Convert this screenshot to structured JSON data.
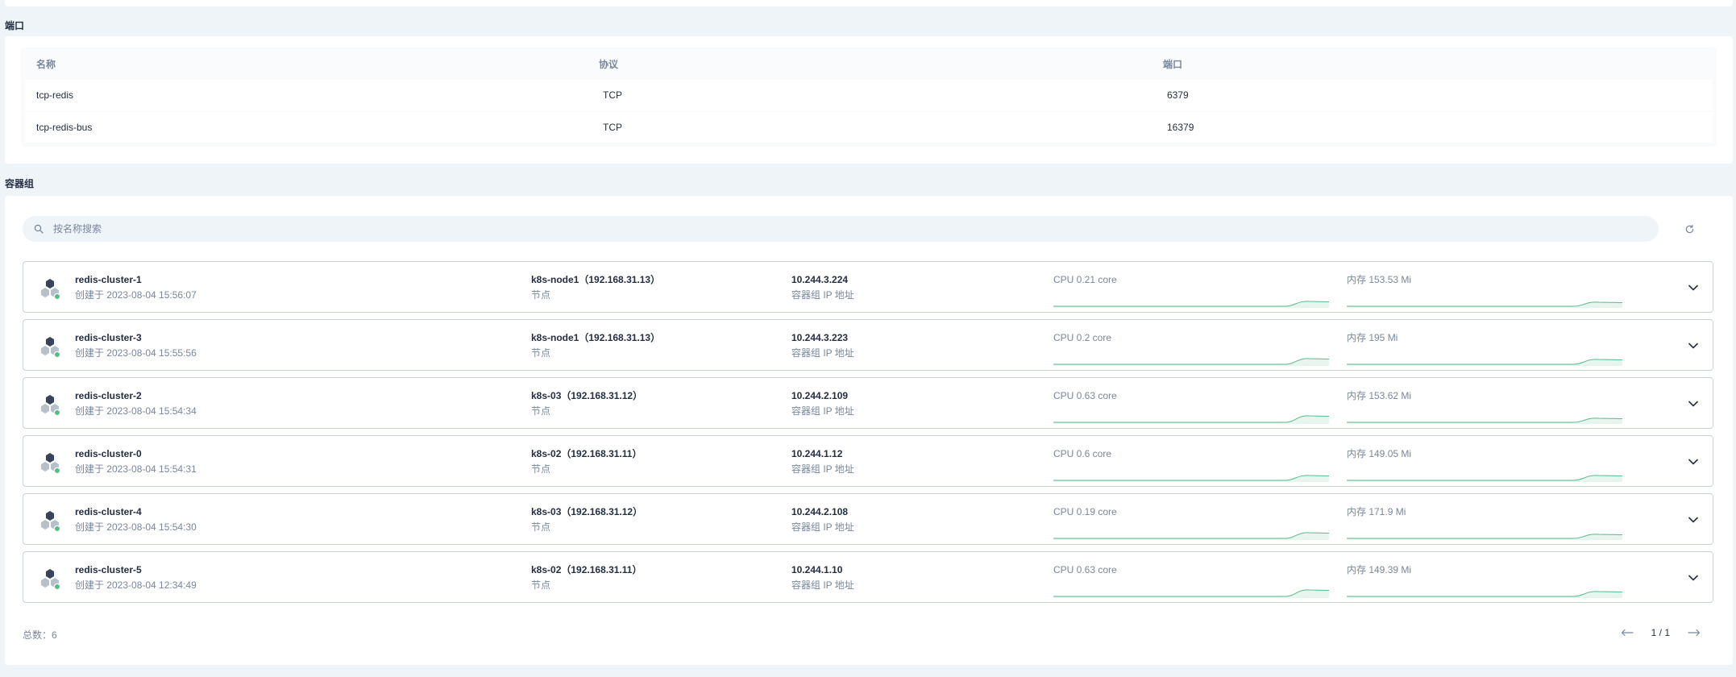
{
  "sections": {
    "ports_title": "端口",
    "pods_title": "容器组"
  },
  "ports": {
    "headers": [
      "名称",
      "协议",
      "端口"
    ],
    "rows": [
      [
        "tcp-redis",
        "TCP",
        "6379"
      ],
      [
        "tcp-redis-bus",
        "TCP",
        "16379"
      ]
    ]
  },
  "search": {
    "placeholder": "按名称搜索"
  },
  "pods": [
    {
      "name": "redis-cluster-1",
      "created": "创建于 2023-08-04 15:56:07",
      "node": "k8s-node1（192.168.31.13）",
      "node_label": "节点",
      "ip": "10.244.3.224",
      "ip_label": "容器组 IP 地址",
      "cpu": "CPU 0.21 core",
      "memory": "内存 153.53 Mi"
    },
    {
      "name": "redis-cluster-3",
      "created": "创建于 2023-08-04 15:55:56",
      "node": "k8s-node1（192.168.31.13）",
      "node_label": "节点",
      "ip": "10.244.3.223",
      "ip_label": "容器组 IP 地址",
      "cpu": "CPU 0.2 core",
      "memory": "内存 195 Mi"
    },
    {
      "name": "redis-cluster-2",
      "created": "创建于 2023-08-04 15:54:34",
      "node": "k8s-03（192.168.31.12）",
      "node_label": "节点",
      "ip": "10.244.2.109",
      "ip_label": "容器组 IP 地址",
      "cpu": "CPU 0.63 core",
      "memory": "内存 153.62 Mi"
    },
    {
      "name": "redis-cluster-0",
      "created": "创建于 2023-08-04 15:54:31",
      "node": "k8s-02（192.168.31.11）",
      "node_label": "节点",
      "ip": "10.244.1.12",
      "ip_label": "容器组 IP 地址",
      "cpu": "CPU 0.6 core",
      "memory": "内存 149.05 Mi"
    },
    {
      "name": "redis-cluster-4",
      "created": "创建于 2023-08-04 15:54:30",
      "node": "k8s-03（192.168.31.12）",
      "node_label": "节点",
      "ip": "10.244.2.108",
      "ip_label": "容器组 IP 地址",
      "cpu": "CPU 0.19 core",
      "memory": "内存 171.9 Mi"
    },
    {
      "name": "redis-cluster-5",
      "created": "创建于 2023-08-04 12:34:49",
      "node": "k8s-02（192.168.31.11）",
      "node_label": "节点",
      "ip": "10.244.1.10",
      "ip_label": "容器组 IP 地址",
      "cpu": "CPU 0.63 core",
      "memory": "内存 149.39 Mi"
    }
  ],
  "footer": {
    "total": "总数：6",
    "page": "1 / 1"
  },
  "colors": {
    "accent": "#55bc8a",
    "text": "#242e42",
    "muted": "#79879c"
  }
}
